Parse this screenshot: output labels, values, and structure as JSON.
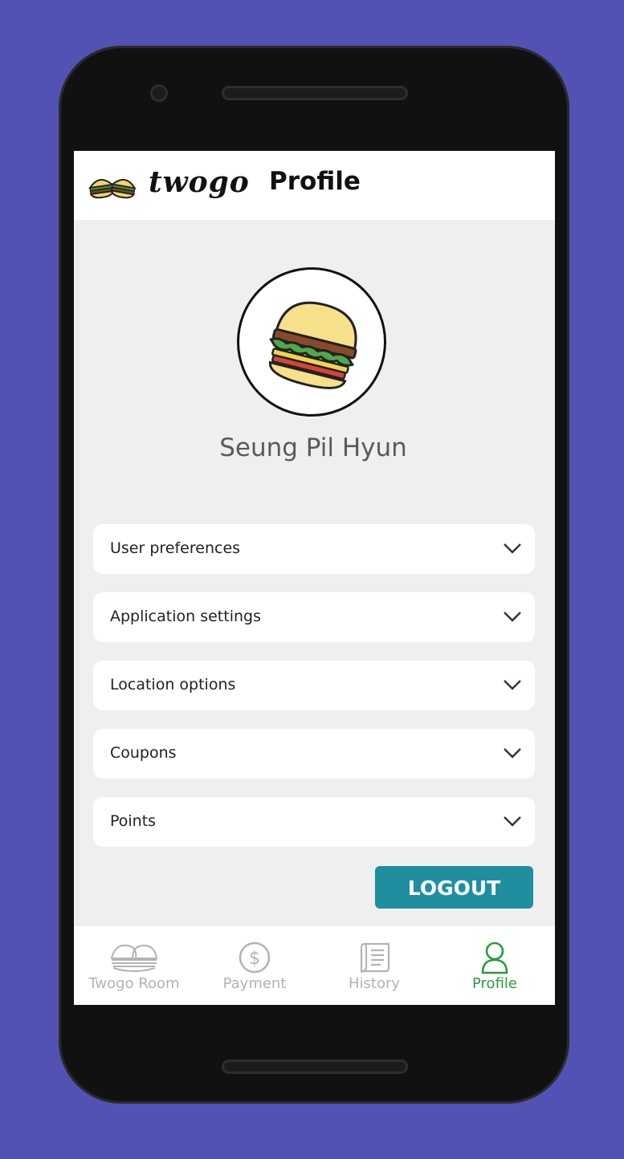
{
  "app": {
    "logo_text": "twogo",
    "logo_icon": "twin-burger-icon"
  },
  "header": {
    "title": "Profile"
  },
  "profile": {
    "avatar_icon": "burger-icon",
    "name": "Seung Pil Hyun"
  },
  "settings": [
    {
      "label": "User preferences",
      "icon": "chevron-down-icon"
    },
    {
      "label": "Application settings",
      "icon": "chevron-down-icon"
    },
    {
      "label": "Location options",
      "icon": "chevron-down-icon"
    },
    {
      "label": "Coupons",
      "icon": "chevron-down-icon"
    },
    {
      "label": "Points",
      "icon": "chevron-down-icon"
    }
  ],
  "logout_label": "LOGOUT",
  "nav": [
    {
      "label": "Twogo Room",
      "icon": "twin-burger-icon",
      "active": false
    },
    {
      "label": "Payment",
      "icon": "dollar-icon",
      "active": false
    },
    {
      "label": "History",
      "icon": "scroll-icon",
      "active": false
    },
    {
      "label": "Profile",
      "icon": "person-icon",
      "active": true
    }
  ],
  "colors": {
    "background": "#5252b5",
    "accent_teal": "#1f8fa0",
    "active_green": "#2f9a3e",
    "inactive_gray": "#b3b3b3"
  }
}
